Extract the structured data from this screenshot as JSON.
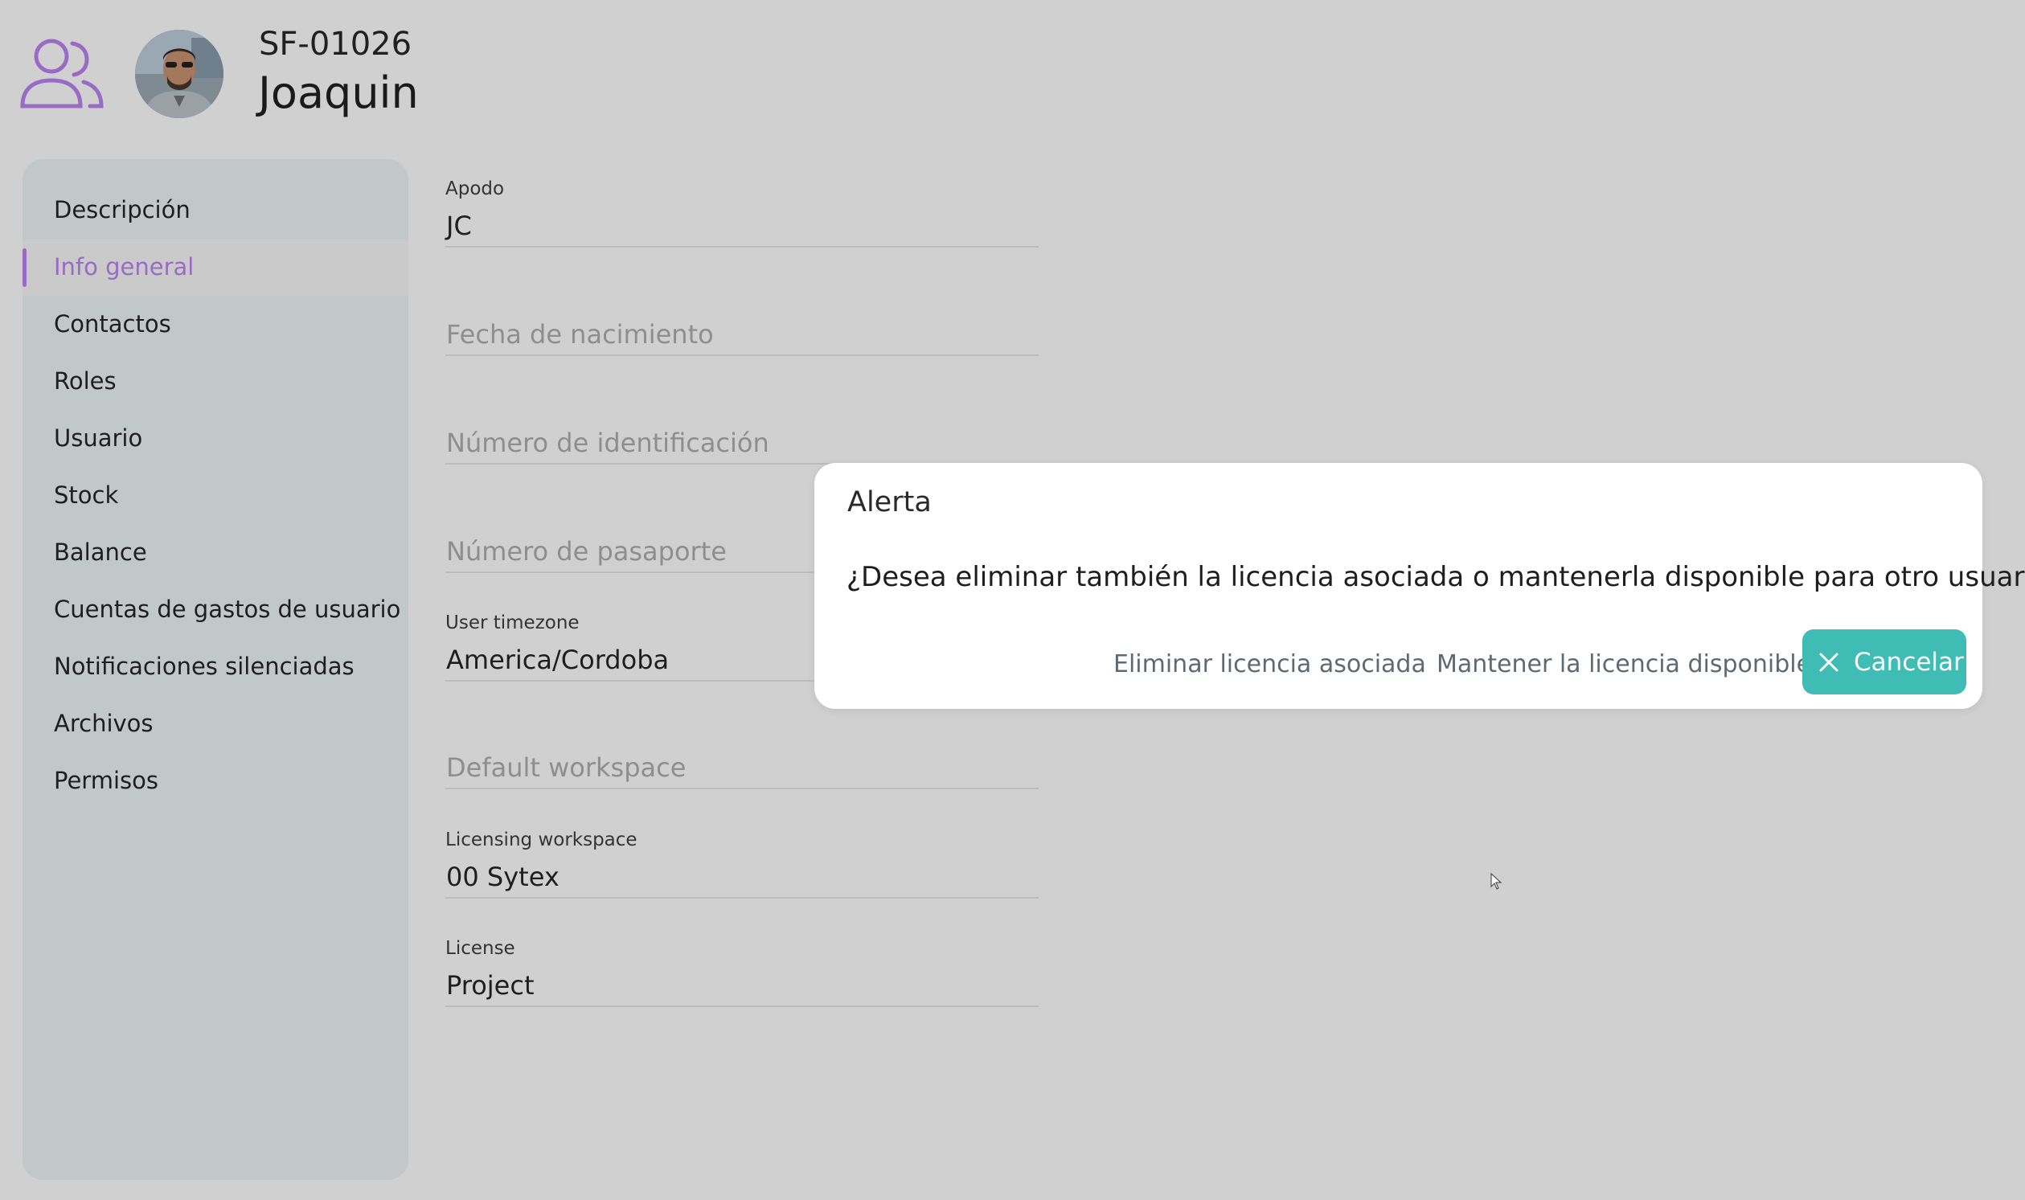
{
  "header": {
    "icon": "users-icon",
    "code": "SF-01026",
    "name": "Joaquin"
  },
  "sidebar": {
    "items": [
      {
        "label": "Descripción"
      },
      {
        "label": "Info general",
        "active": true
      },
      {
        "label": "Contactos"
      },
      {
        "label": "Roles"
      },
      {
        "label": "Usuario"
      },
      {
        "label": "Stock"
      },
      {
        "label": "Balance"
      },
      {
        "label": "Cuentas de gastos de usuario"
      },
      {
        "label": "Notificaciones silenciadas"
      },
      {
        "label": "Archivos"
      },
      {
        "label": "Permisos"
      }
    ]
  },
  "form": {
    "apodo": {
      "label": "Apodo",
      "value": "JC"
    },
    "fecha_nacimiento": {
      "placeholder": "Fecha de nacimiento"
    },
    "numero_identificacion": {
      "placeholder": "Número de identificación"
    },
    "numero_pasaporte": {
      "placeholder": "Número de pasaporte"
    },
    "user_timezone": {
      "label": "User timezone",
      "value": "America/Cordoba"
    },
    "default_workspace": {
      "placeholder": "Default workspace"
    },
    "licensing_workspace": {
      "label": "Licensing workspace",
      "value": "00 Sytex"
    },
    "license": {
      "label": "License",
      "value": "Project"
    }
  },
  "dialog": {
    "title": "Alerta",
    "message": "¿Desea eliminar también la licencia asociada o mantenerla disponible para otro usuario?",
    "eliminar_label": "Eliminar licencia asociada",
    "mantener_label": "Mantener la licencia disponible",
    "cancel_label": "Cancelar",
    "cancel_icon": "close-icon"
  },
  "colors": {
    "accent_purple": "#9a6bc4",
    "primary_teal": "#3fbcb4",
    "sidebar_bg": "#c2c7ca",
    "overlay_bg": "#d0d0d0"
  }
}
